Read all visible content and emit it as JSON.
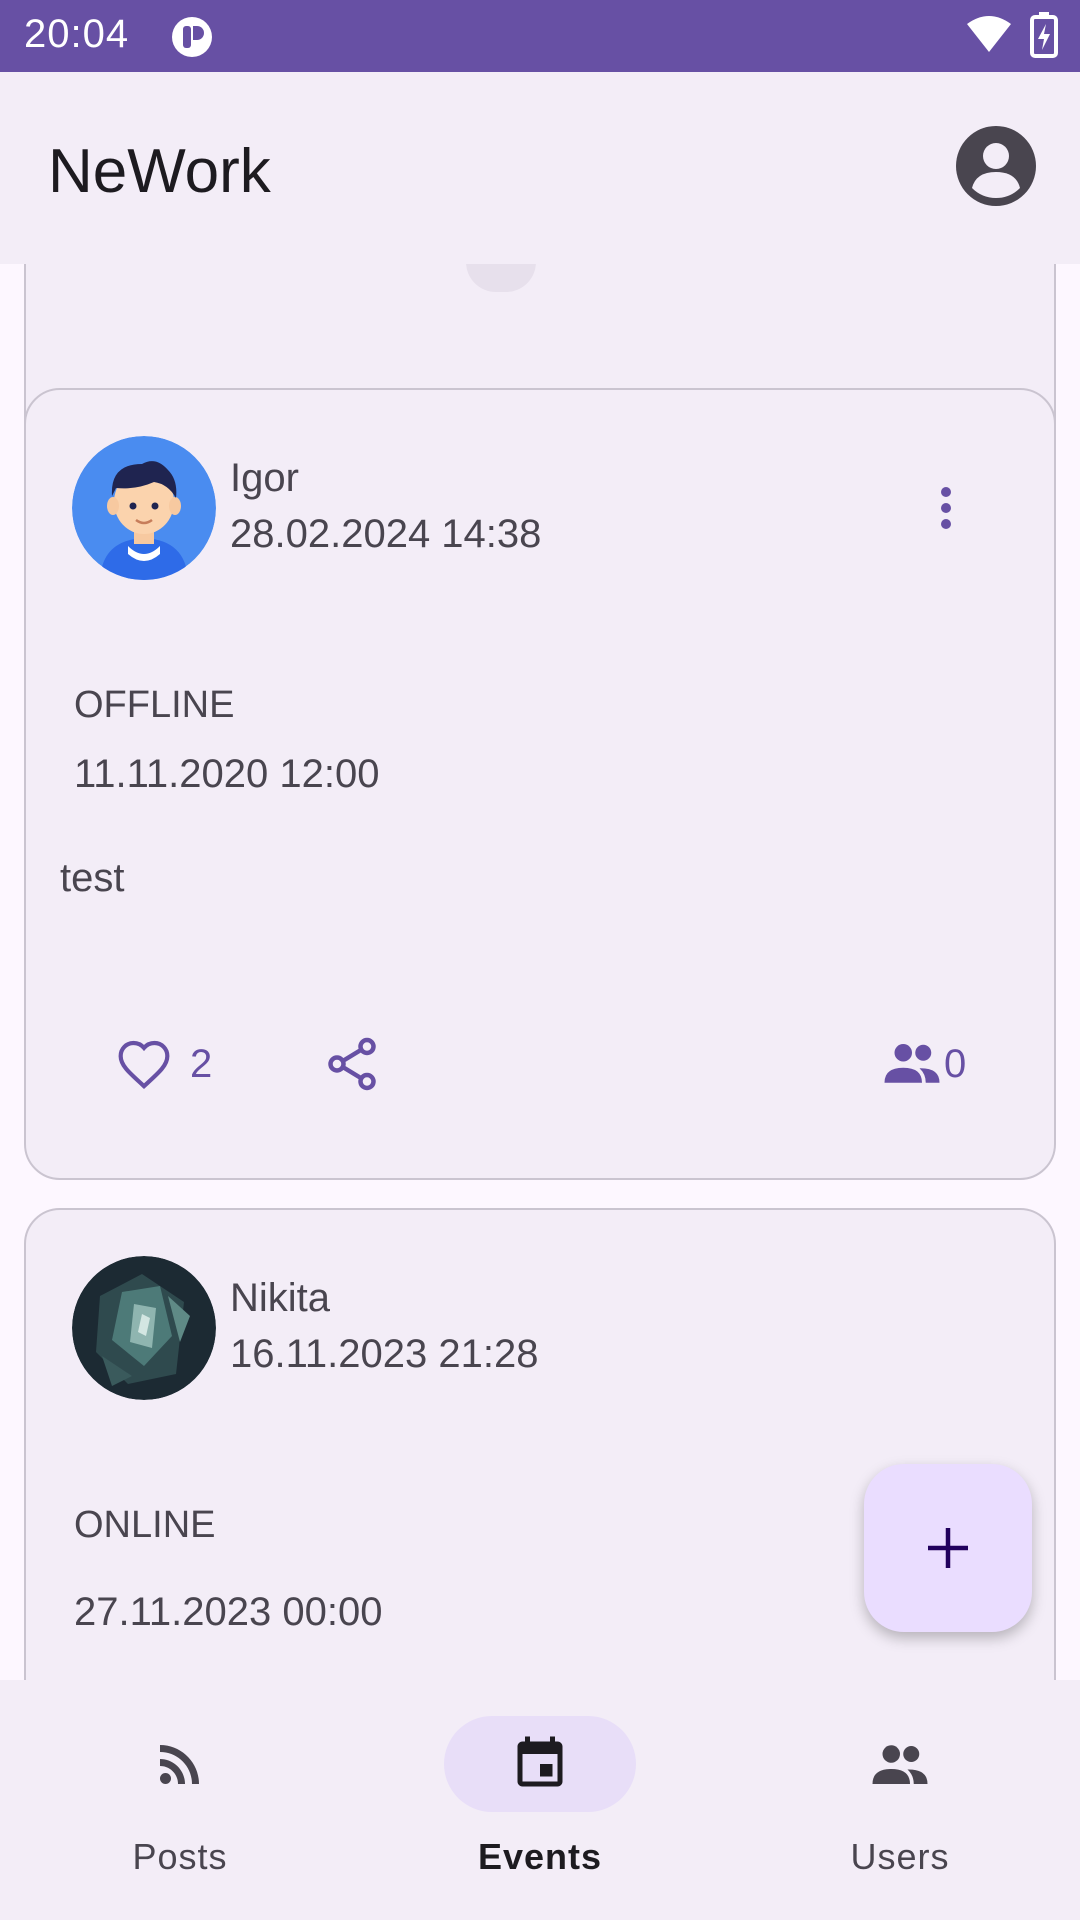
{
  "status_bar": {
    "time": "20:04",
    "wifi_icon": "wifi-icon",
    "battery_icon": "battery-charging-icon"
  },
  "app_bar": {
    "title": "NeWork",
    "account_icon": "account-circle-icon"
  },
  "events": [
    {
      "author": "Igor",
      "published": "28.02.2024 14:38",
      "type": "OFFLINE",
      "datetime": "11.11.2020 12:00",
      "content": "test",
      "likes": "2",
      "participants": "0"
    },
    {
      "author": "Nikita",
      "published": "16.11.2023 21:28",
      "type": "ONLINE",
      "datetime": "27.11.2023 00:00"
    }
  ],
  "fab": {
    "icon": "plus-icon"
  },
  "bottom_nav": [
    {
      "label": "Posts",
      "icon": "rss-feed-icon",
      "active": false
    },
    {
      "label": "Events",
      "icon": "event-calendar-icon",
      "active": true
    },
    {
      "label": "Users",
      "icon": "people-icon",
      "active": false
    }
  ],
  "colors": {
    "primary": "#6750a4",
    "surface": "#f3edf7",
    "background": "#fdf7ff",
    "fab": "#eaddff",
    "nav_indicator": "#e8def8"
  }
}
